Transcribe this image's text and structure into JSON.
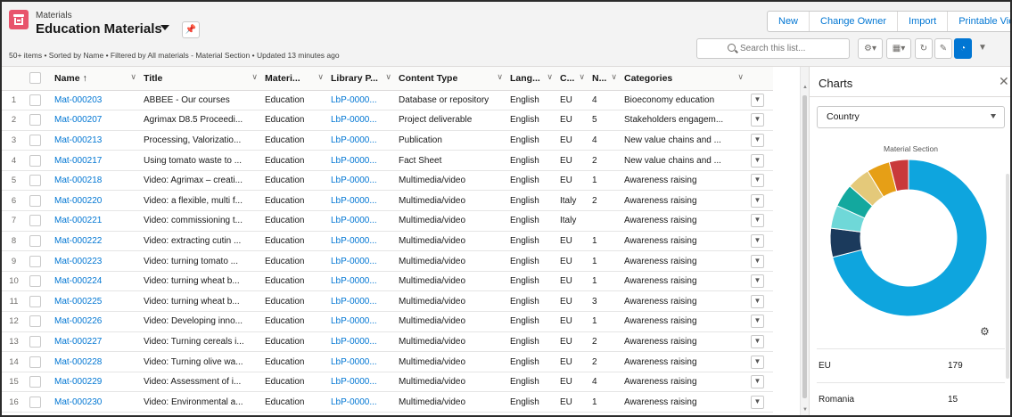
{
  "header": {
    "object_label": "Materials",
    "list_title": "Education Materials",
    "meta": "50+ items • Sorted by Name • Filtered by All materials - Material Section • Updated 13 minutes ago",
    "buttons": [
      "New",
      "Change Owner",
      "Import",
      "Printable View"
    ],
    "search_placeholder": "Search this list..."
  },
  "table": {
    "columns": [
      "Name ↑",
      "Title",
      "Materi...",
      "Library P...",
      "Content Type",
      "Lang...",
      "C...",
      "N...",
      "Categories"
    ],
    "rows": [
      {
        "n": "1",
        "name": "Mat-000203",
        "title": "ABBEE - Our courses",
        "material": "Education",
        "library": "LbP-0000...",
        "content": "Database or repository",
        "lang": "English",
        "c": "EU",
        "num": "4",
        "cat": "Bioeconomy education"
      },
      {
        "n": "2",
        "name": "Mat-000207",
        "title": "Agrimax D8.5 Proceedi...",
        "material": "Education",
        "library": "LbP-0000...",
        "content": "Project deliverable",
        "lang": "English",
        "c": "EU",
        "num": "5",
        "cat": "Stakeholders engagem..."
      },
      {
        "n": "3",
        "name": "Mat-000213",
        "title": "Processing, Valorizatio...",
        "material": "Education",
        "library": "LbP-0000...",
        "content": "Publication",
        "lang": "English",
        "c": "EU",
        "num": "4",
        "cat": "New value chains and ..."
      },
      {
        "n": "4",
        "name": "Mat-000217",
        "title": "Using tomato waste to ...",
        "material": "Education",
        "library": "LbP-0000...",
        "content": "Fact Sheet",
        "lang": "English",
        "c": "EU",
        "num": "2",
        "cat": "New value chains and ..."
      },
      {
        "n": "5",
        "name": "Mat-000218",
        "title": "Video: Agrimax – creati...",
        "material": "Education",
        "library": "LbP-0000...",
        "content": "Multimedia/video",
        "lang": "English",
        "c": "EU",
        "num": "1",
        "cat": "Awareness raising"
      },
      {
        "n": "6",
        "name": "Mat-000220",
        "title": "Video: a flexible, multi f...",
        "material": "Education",
        "library": "LbP-0000...",
        "content": "Multimedia/video",
        "lang": "English",
        "c": "Italy",
        "num": "2",
        "cat": "Awareness raising"
      },
      {
        "n": "7",
        "name": "Mat-000221",
        "title": "Video: commissioning t...",
        "material": "Education",
        "library": "LbP-0000...",
        "content": "Multimedia/video",
        "lang": "English",
        "c": "Italy",
        "num": "",
        "cat": "Awareness raising"
      },
      {
        "n": "8",
        "name": "Mat-000222",
        "title": "Video: extracting cutin ...",
        "material": "Education",
        "library": "LbP-0000...",
        "content": "Multimedia/video",
        "lang": "English",
        "c": "EU",
        "num": "1",
        "cat": "Awareness raising"
      },
      {
        "n": "9",
        "name": "Mat-000223",
        "title": "Video: turning tomato ...",
        "material": "Education",
        "library": "LbP-0000...",
        "content": "Multimedia/video",
        "lang": "English",
        "c": "EU",
        "num": "1",
        "cat": "Awareness raising"
      },
      {
        "n": "10",
        "name": "Mat-000224",
        "title": "Video: turning wheat b...",
        "material": "Education",
        "library": "LbP-0000...",
        "content": "Multimedia/video",
        "lang": "English",
        "c": "EU",
        "num": "1",
        "cat": "Awareness raising"
      },
      {
        "n": "11",
        "name": "Mat-000225",
        "title": "Video: turning wheat b...",
        "material": "Education",
        "library": "LbP-0000...",
        "content": "Multimedia/video",
        "lang": "English",
        "c": "EU",
        "num": "3",
        "cat": "Awareness raising"
      },
      {
        "n": "12",
        "name": "Mat-000226",
        "title": "Video: Developing inno...",
        "material": "Education",
        "library": "LbP-0000...",
        "content": "Multimedia/video",
        "lang": "English",
        "c": "EU",
        "num": "1",
        "cat": "Awareness raising"
      },
      {
        "n": "13",
        "name": "Mat-000227",
        "title": "Video: Turning cereals i...",
        "material": "Education",
        "library": "LbP-0000...",
        "content": "Multimedia/video",
        "lang": "English",
        "c": "EU",
        "num": "2",
        "cat": "Awareness raising"
      },
      {
        "n": "14",
        "name": "Mat-000228",
        "title": "Video: Turning olive wa...",
        "material": "Education",
        "library": "LbP-0000...",
        "content": "Multimedia/video",
        "lang": "English",
        "c": "EU",
        "num": "2",
        "cat": "Awareness raising"
      },
      {
        "n": "15",
        "name": "Mat-000229",
        "title": "Video: Assessment of i...",
        "material": "Education",
        "library": "LbP-0000...",
        "content": "Multimedia/video",
        "lang": "English",
        "c": "EU",
        "num": "4",
        "cat": "Awareness raising"
      },
      {
        "n": "16",
        "name": "Mat-000230",
        "title": "Video: Environmental a...",
        "material": "Education",
        "library": "LbP-0000...",
        "content": "Multimedia/video",
        "lang": "English",
        "c": "EU",
        "num": "1",
        "cat": "Awareness raising"
      }
    ]
  },
  "charts": {
    "title": "Charts",
    "group_by": "Country",
    "caption": "Material Section",
    "legend": [
      {
        "label": "EU",
        "value": "179"
      },
      {
        "label": "Romania",
        "value": "15"
      }
    ]
  },
  "chart_data": {
    "type": "pie",
    "title": "Material Section",
    "segments": [
      {
        "value": 179,
        "color": "#0ea5de"
      },
      {
        "value": 15,
        "color": "#1b3a5c"
      },
      {
        "value": 12,
        "color": "#6fd8d8"
      },
      {
        "value": 12,
        "color": "#13a89e"
      },
      {
        "value": 12,
        "color": "#e4c97a"
      },
      {
        "value": 12,
        "color": "#e69f16"
      },
      {
        "value": 10,
        "color": "#c9393b"
      }
    ]
  },
  "colors": {
    "brand_icon": "#e8546c",
    "link": "#0176d3",
    "active_tool": "#0176d3"
  }
}
